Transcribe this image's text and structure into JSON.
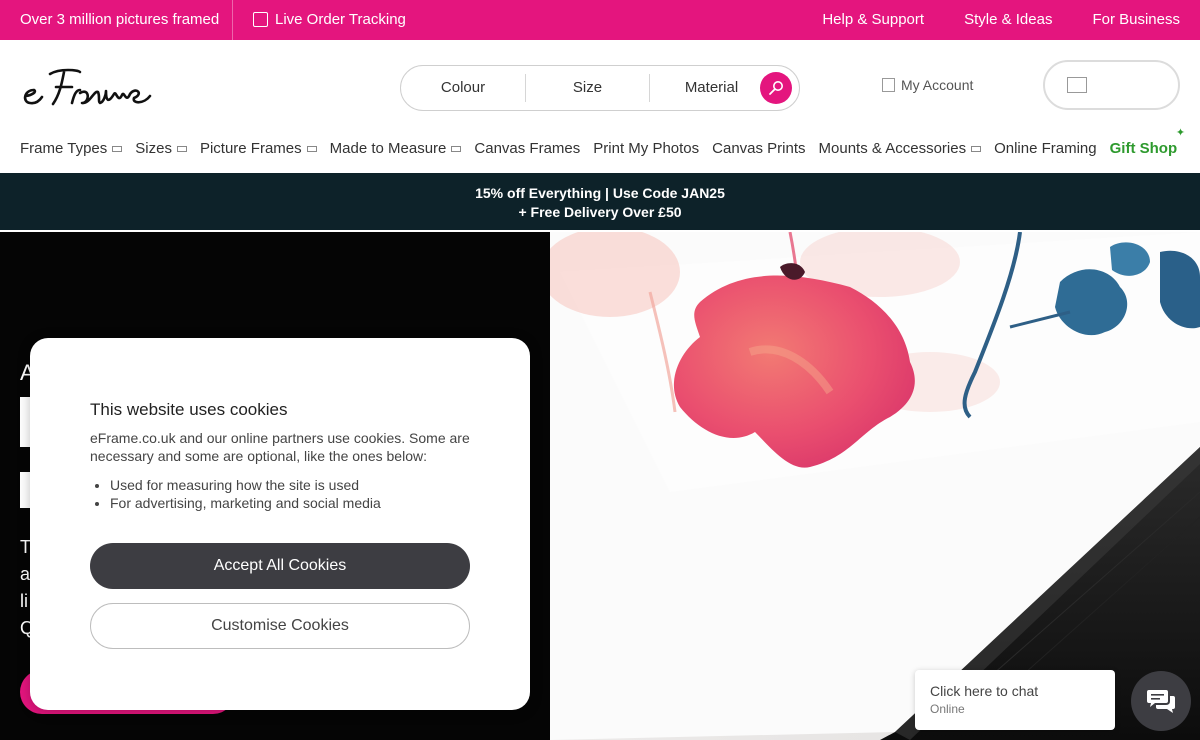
{
  "topbar": {
    "promo": "Over 3 million pictures framed",
    "tracking": "Live Order Tracking",
    "links": [
      "Help & Support",
      "Style & Ideas",
      "For Business"
    ]
  },
  "header": {
    "logo_text": "eFrame",
    "search_segments": [
      "Colour",
      "Size",
      "Material"
    ],
    "account": "My Account"
  },
  "nav": {
    "items": [
      {
        "label": "Frame Types",
        "dropdown": true
      },
      {
        "label": "Sizes",
        "dropdown": true
      },
      {
        "label": "Picture Frames",
        "dropdown": true
      },
      {
        "label": "Made to Measure",
        "dropdown": true
      },
      {
        "label": "Canvas Frames",
        "dropdown": false
      },
      {
        "label": "Print My Photos",
        "dropdown": false
      },
      {
        "label": "Canvas Prints",
        "dropdown": false
      },
      {
        "label": "Mounts & Accessories",
        "dropdown": true
      },
      {
        "label": "Online Framing",
        "dropdown": false
      }
    ],
    "gift": "Gift Shop"
  },
  "strip": {
    "line1": "15% off Everything | Use Code JAN25",
    "line2": "+ Free Delivery Over £50"
  },
  "hero": {
    "partial_text_1": "A",
    "partial_lines": [
      "T",
      "a",
      "li",
      "Q"
    ]
  },
  "cookie": {
    "title": "This website uses cookies",
    "body": "eFrame.co.uk and our online partners use cookies. Some are necessary and some are optional, like the ones below:",
    "bullets": [
      "Used for measuring how the site is used",
      "For advertising, marketing and social media"
    ],
    "accept": "Accept All Cookies",
    "customise": "Customise Cookies"
  },
  "chat": {
    "label": "Click here to chat",
    "status": "Online"
  },
  "colors": {
    "brand_pink": "#e4157e",
    "strip_dark": "#0d2229",
    "button_dark": "#3d3d42",
    "gift_green": "#2e9a2e"
  }
}
